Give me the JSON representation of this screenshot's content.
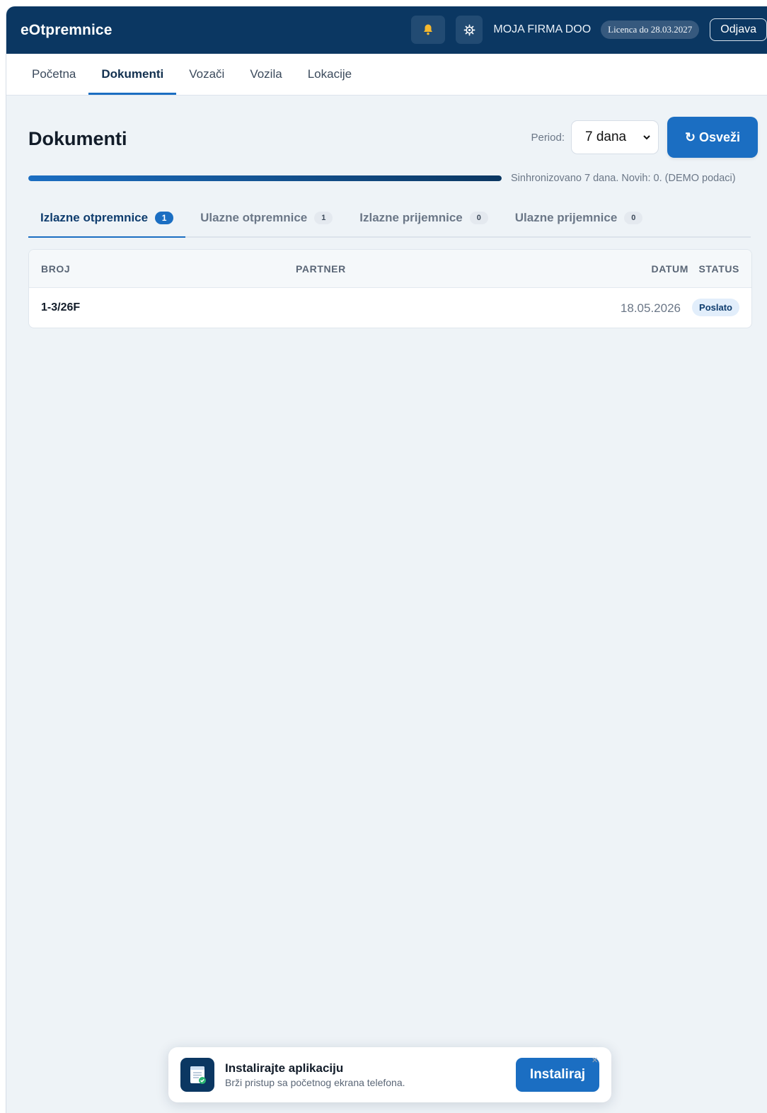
{
  "header": {
    "brand": "eOtpremnice",
    "company": "MOJA FIRMA DOO",
    "license": "Licenca do 28.03.2027",
    "logout": "Odjava",
    "notification_icon": "bell-icon",
    "settings_icon": "gear-icon"
  },
  "nav": {
    "items": [
      {
        "label": "Početna"
      },
      {
        "label": "Dokumenti",
        "active": true
      },
      {
        "label": "Vozači"
      },
      {
        "label": "Vozila"
      },
      {
        "label": "Lokacije"
      }
    ]
  },
  "page": {
    "title": "Dokumenti",
    "period_label": "Period:",
    "period_value": "7 dana",
    "refresh_label": "↻ Osveži",
    "sync_progress": 1.0,
    "sync_text": "Sinhronizovano 7 dana. Novih: 0. (DEMO podaci)"
  },
  "doc_tabs": [
    {
      "label": "Izlazne otpremnice",
      "count": "1",
      "active": true
    },
    {
      "label": "Ulazne otpremnice",
      "count": "1"
    },
    {
      "label": "Izlazne prijemnice",
      "count": "0"
    },
    {
      "label": "Ulazne prijemnice",
      "count": "0"
    }
  ],
  "table": {
    "columns": {
      "broj": "BROJ",
      "partner": "PARTNER",
      "datum": "DATUM",
      "status": "STATUS"
    },
    "rows": [
      {
        "broj": "1-3/26F",
        "partner": "",
        "datum": "18.05.2026",
        "status": "Poslato"
      }
    ]
  },
  "install": {
    "title": "Instalirajte aplikaciju",
    "subtitle": "Brži pristup sa početnog ekrana telefona.",
    "button": "Instaliraj",
    "close": "×"
  },
  "colors": {
    "header_bg": "#0b3762",
    "accent": "#1b6ec2",
    "page_bg": "#eef3f7"
  }
}
